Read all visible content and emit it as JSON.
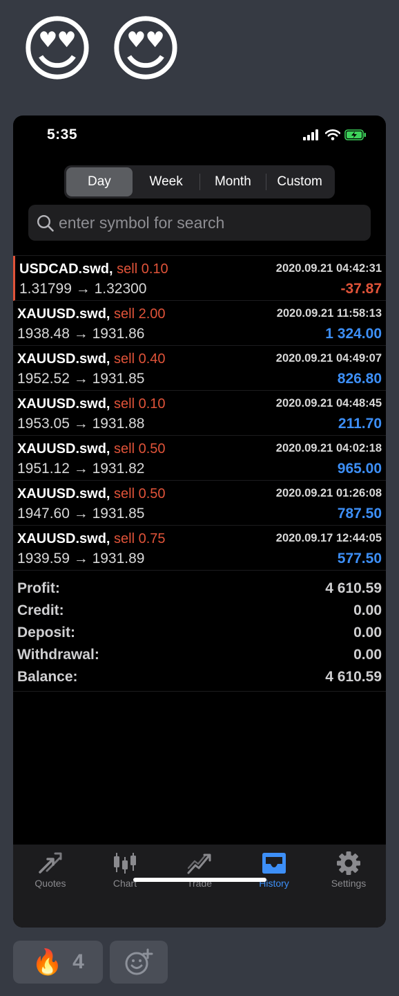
{
  "post": {
    "reaction_emojis": [
      "😍",
      "😍"
    ],
    "reactions": {
      "fire_emoji": "🔥",
      "fire_count": "4",
      "add_reaction_icon": "smiley-plus-icon"
    }
  },
  "status_bar": {
    "time": "5:35",
    "icons": [
      "cellular-signal-icon",
      "wifi-icon",
      "battery-charging-icon"
    ]
  },
  "filter": {
    "tabs": [
      "Day",
      "Week",
      "Month",
      "Custom"
    ],
    "selected": "Day"
  },
  "search": {
    "placeholder": "enter symbol for search"
  },
  "trades": [
    {
      "symbol": "USDCAD.swd,",
      "side": "sell 0.10",
      "date": "2020.09.21 04:42:31",
      "prices": "1.31799 → 1.32300",
      "profit": "-37.87",
      "profit_sign": "neg"
    },
    {
      "symbol": "XAUUSD.swd,",
      "side": "sell 2.00",
      "date": "2020.09.21 11:58:13",
      "prices": "1938.48 → 1931.86",
      "profit": "1 324.00",
      "profit_sign": "pos"
    },
    {
      "symbol": "XAUUSD.swd,",
      "side": "sell 0.40",
      "date": "2020.09.21 04:49:07",
      "prices": "1952.52 → 1931.85",
      "profit": "826.80",
      "profit_sign": "pos"
    },
    {
      "symbol": "XAUUSD.swd,",
      "side": "sell 0.10",
      "date": "2020.09.21 04:48:45",
      "prices": "1953.05 → 1931.88",
      "profit": "211.70",
      "profit_sign": "pos"
    },
    {
      "symbol": "XAUUSD.swd,",
      "side": "sell 0.50",
      "date": "2020.09.21 04:02:18",
      "prices": "1951.12 → 1931.82",
      "profit": "965.00",
      "profit_sign": "pos"
    },
    {
      "symbol": "XAUUSD.swd,",
      "side": "sell 0.50",
      "date": "2020.09.21 01:26:08",
      "prices": "1947.60 → 1931.85",
      "profit": "787.50",
      "profit_sign": "pos"
    },
    {
      "symbol": "XAUUSD.swd,",
      "side": "sell 0.75",
      "date": "2020.09.17 12:44:05",
      "prices": "1939.59 → 1931.89",
      "profit": "577.50",
      "profit_sign": "pos"
    }
  ],
  "summary": {
    "profit_label": "Profit:",
    "profit_value": "4 610.59",
    "credit_label": "Credit:",
    "credit_value": "0.00",
    "deposit_label": "Deposit:",
    "deposit_value": "0.00",
    "withdrawal_label": "Withdrawal:",
    "withdrawal_value": "0.00",
    "balance_label": "Balance:",
    "balance_value": "4 610.59"
  },
  "tabbar": {
    "items": [
      {
        "label": "Quotes",
        "icon": "quotes-arrows-icon"
      },
      {
        "label": "Chart",
        "icon": "candlestick-chart-icon"
      },
      {
        "label": "Trade",
        "icon": "trade-chart-icon"
      },
      {
        "label": "History",
        "icon": "history-inbox-icon"
      },
      {
        "label": "Settings",
        "icon": "gear-icon"
      }
    ],
    "active": "History"
  },
  "colors": {
    "sell": "#e05339",
    "profit_positive": "#3d8ff7",
    "profit_negative": "#e05339",
    "accent": "#3d8ff7",
    "background": "#363a43"
  }
}
